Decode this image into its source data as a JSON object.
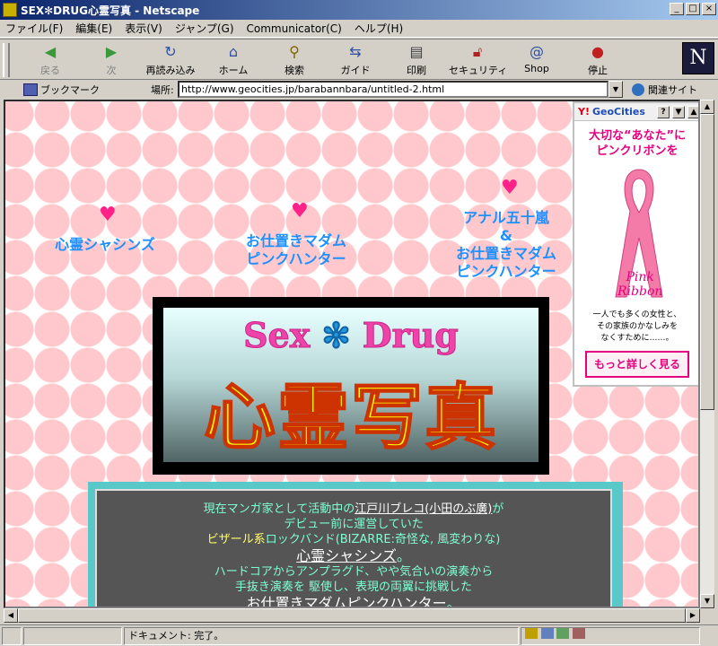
{
  "window": {
    "title": "SEX✻DRUG心霊写真 - Netscape",
    "controls": [
      "_",
      "□",
      "×"
    ]
  },
  "menu": [
    "ファイル(F)",
    "編集(E)",
    "表示(V)",
    "ジャンプ(G)",
    "Communicator(C)",
    "ヘルプ(H)"
  ],
  "toolbar": {
    "back": "戻る",
    "forward": "次",
    "reload": "再読み込み",
    "home": "ホーム",
    "search": "検索",
    "guide": "ガイド",
    "print": "印刷",
    "security": "セキュリティ",
    "shop": "Shop",
    "stop": "停止"
  },
  "location": {
    "bookmarks": "ブックマーク",
    "label": "場所:",
    "url": "http://www.geocities.jp/barabannbara/untitled-2.html",
    "related": "関連サイト"
  },
  "page": {
    "links": [
      {
        "lines": [
          "心霊シャシンズ"
        ]
      },
      {
        "lines": [
          "お仕置きマダム",
          "ピンクハンター"
        ]
      },
      {
        "lines": [
          "アナル五十嵐",
          "&",
          "お仕置きマダム",
          "ピンクハンター"
        ]
      }
    ],
    "banner": {
      "sub_left": "Sex",
      "sub_star": "✻",
      "sub_right": "Drug",
      "main": "心霊写真"
    },
    "intro": {
      "l1_a": "現在マンガ家として活動中の",
      "l1_link": "江戸川ブレコ(小田のぶ廣)",
      "l1_b": "が",
      "l2": "デビュー前に運営していた",
      "l3_a": "ビザール系",
      "l3_b": "ロックバンド(BIZARRE:奇怪な, 風変わりな)",
      "l4_link": "心霊シャシンズ",
      "l4_b": "。",
      "l5": "ハードコアからアンプラグド、やや気合いの演奏から",
      "l6": "手抜き演奏を 駆使し、表現の両翼に挑戦した",
      "l7_link": "お仕置きマダムピンクハンター",
      "l7_b": "。"
    },
    "ad": {
      "brand_y": "Y!",
      "brand": "GeoCities",
      "help": "?",
      "title_l1": "大切な“あなた”に",
      "title_l2": "ピンクリボンを",
      "pink_l1": "Pink",
      "pink_l2": "Ribbon",
      "desc_l1": "一人でも多くの女性と、",
      "desc_l2": "その家族のかなしみを",
      "desc_l3": "なくすために……。",
      "more": "もっと詳しく見る"
    }
  },
  "status": {
    "text": "ドキュメント: 完了。"
  },
  "colors": {
    "title_bar": "#0a246a",
    "link": "#1e90ff",
    "heart": "#ff2288",
    "ad_pink": "#e4007f"
  }
}
